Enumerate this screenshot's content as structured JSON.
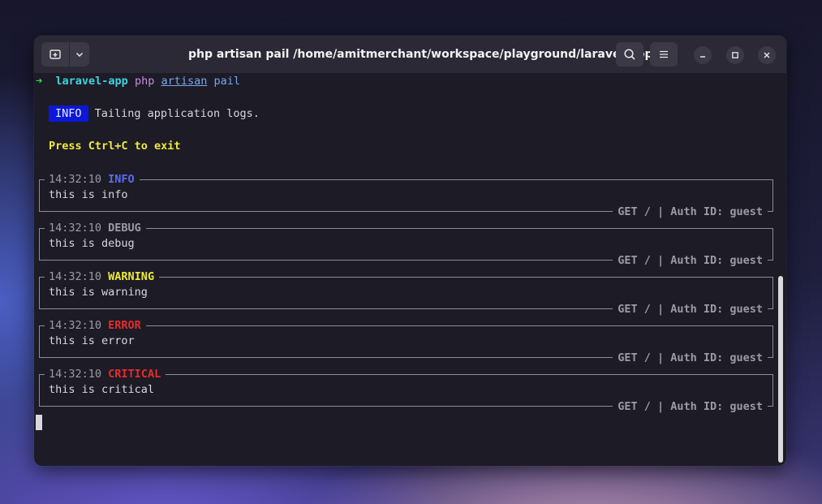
{
  "window": {
    "title": "php artisan pail /home/amitmerchant/workspace/playground/laravel-app"
  },
  "prompt": {
    "arrow": "➜",
    "directory": "laravel-app",
    "command": "php",
    "arg1": "artisan",
    "arg2": "pail"
  },
  "info_line": {
    "badge": "INFO",
    "text": "Tailing application logs."
  },
  "exit_hint": "Press Ctrl+C to exit",
  "logs": [
    {
      "time": "14:32:10",
      "level": "INFO",
      "message": "this is info",
      "footer": "GET / | Auth ID: guest"
    },
    {
      "time": "14:32:10",
      "level": "DEBUG",
      "message": "this is debug",
      "footer": "GET / | Auth ID: guest"
    },
    {
      "time": "14:32:10",
      "level": "WARNING",
      "message": "this is warning",
      "footer": "GET / | Auth ID: guest"
    },
    {
      "time": "14:32:10",
      "level": "ERROR",
      "message": "this is error",
      "footer": "GET / | Auth ID: guest"
    },
    {
      "time": "14:32:10",
      "level": "CRITICAL",
      "message": "this is critical",
      "footer": "GET / | Auth ID: guest"
    }
  ],
  "icons": {
    "new_tab": "new-tab-icon",
    "dropdown": "chevron-down-icon",
    "search": "search-icon",
    "menu": "hamburger-menu-icon",
    "minimize": "minimize-icon",
    "maximize": "maximize-icon",
    "close": "close-icon"
  },
  "colors": {
    "info": "#5a6bf2",
    "debug": "#9c9aa4",
    "warning": "#ecea3a",
    "error": "#e42d2d",
    "critical": "#e42d2d",
    "badge_bg": "#0b18d8"
  }
}
